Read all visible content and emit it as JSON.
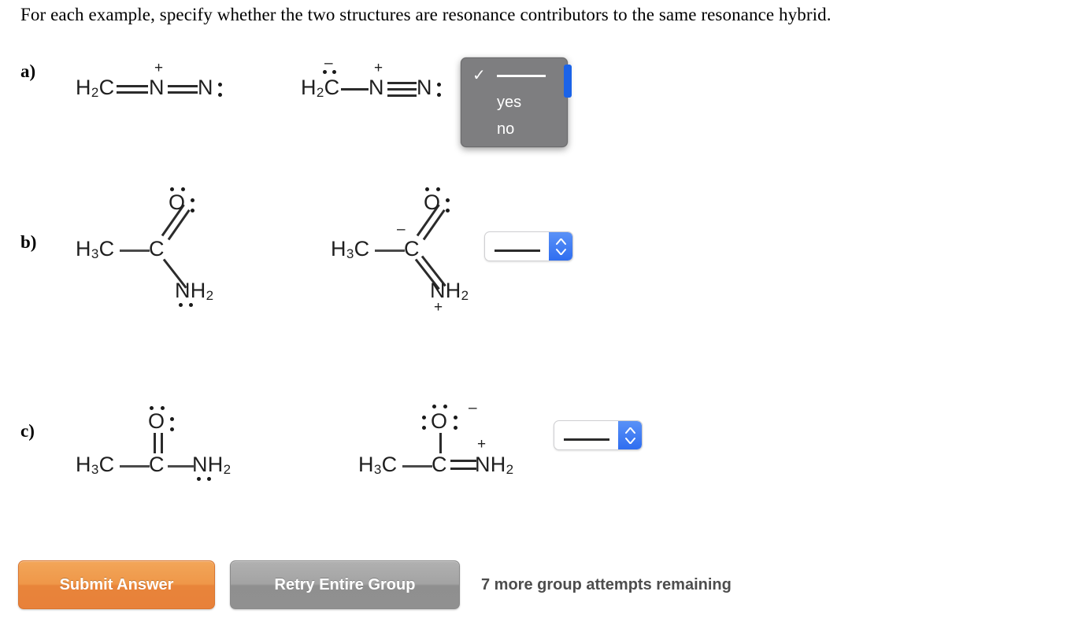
{
  "prompt": "For each example, specify whether the two structures are resonance contributors to the same resonance hybrid.",
  "colors": {
    "submit_button": "#ef9749",
    "retry_button": "#a3a3a3",
    "select_accent": "#2f6ef0",
    "popup_background": "#7e7e80"
  },
  "rows": [
    {
      "label": "a)",
      "left_structure": {
        "name": "diazomethane-resonance-1",
        "atoms": [
          "H",
          "2",
          "C",
          "N",
          "N"
        ],
        "formula_text": "H2C=N(+)=N:",
        "charges": [
          "+"
        ],
        "left_group": "H",
        "left_sub": "2",
        "left_atom": "C",
        "center_atom": "N",
        "right_atom": "N",
        "center_charge": "+"
      },
      "right_structure": {
        "name": "diazomethane-resonance-2",
        "formula_text": "H2C(-)-N(+)#N:",
        "left_group": "H",
        "left_sub": "2",
        "left_atom": "C",
        "center_atom": "N",
        "right_atom": "N",
        "left_charge": "–",
        "center_charge": "+"
      },
      "control": {
        "type": "select-open",
        "name": "answer-dropdown-a",
        "selected": "",
        "options": [
          "",
          "yes",
          "no"
        ],
        "option_blank_label": "",
        "option_yes_label": "yes",
        "option_no_label": "no",
        "checked_index": 0
      }
    },
    {
      "label": "b)",
      "left_structure": {
        "name": "acetamide-neutral",
        "methyl": "H",
        "methyl_sub": "3",
        "methyl_atom": "C",
        "carbonyl_atom": "C",
        "oxygen_atom": "O",
        "amine": "NH",
        "amine_sub": "2",
        "charges": []
      },
      "right_structure": {
        "name": "acetamide-carbanion-incorrect",
        "methyl": "H",
        "methyl_sub": "3",
        "methyl_atom": "C",
        "carbonyl_atom": "C",
        "oxygen_atom": "O",
        "amine": "NH",
        "amine_sub": "2",
        "carbon_charge": "–",
        "nitrogen_charge": "+"
      },
      "control": {
        "type": "select-closed",
        "name": "answer-dropdown-b",
        "selected": "",
        "options": [
          "",
          "yes",
          "no"
        ]
      }
    },
    {
      "label": "c)",
      "left_structure": {
        "name": "acetamide-linear-neutral",
        "methyl": "H",
        "methyl_sub": "3",
        "methyl_atom": "C",
        "carbonyl_atom": "C",
        "oxygen_atom": "O",
        "amine": "NH",
        "amine_sub": "2",
        "charges": []
      },
      "right_structure": {
        "name": "acetamide-zwitterion",
        "methyl": "H",
        "methyl_sub": "3",
        "methyl_atom": "C",
        "carbonyl_atom": "C",
        "oxygen_atom": "O",
        "amine": "NH",
        "amine_sub": "2",
        "oxygen_charge": "–",
        "nitrogen_charge": "+"
      },
      "control": {
        "type": "select-closed",
        "name": "answer-dropdown-c",
        "selected": "",
        "options": [
          "",
          "yes",
          "no"
        ]
      }
    }
  ],
  "footer": {
    "submit_label": "Submit Answer",
    "retry_label": "Retry Entire Group",
    "attempts_text": "7 more group attempts remaining"
  }
}
